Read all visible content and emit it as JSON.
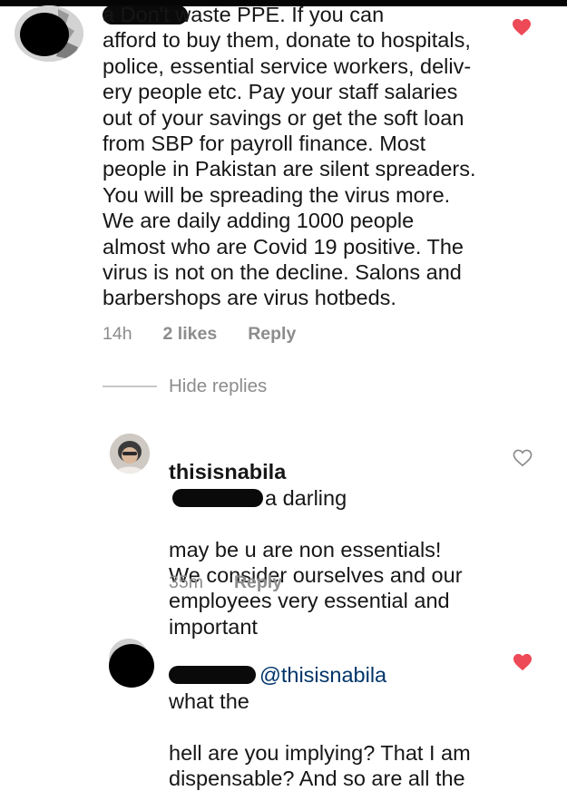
{
  "comments": [
    {
      "text": "a Don't waste PPE. If you can\nafford to buy them, donate to hospitals,\npolice, essential service workers, deliv-\nery people etc. Pay your staff salaries\nout of your savings or get the soft loan\nfrom SBP for payroll finance. Most\npeople in Pakistan are silent spreaders.\nYou will be spreading the virus more.\nWe are daily adding 1000 people\nalmost who are Covid 19 positive. The\nvirus is not on the decline. Salons and\nbarbershops are virus hotbeds.",
      "time": "14h",
      "likes": "2 likes",
      "reply": "Reply",
      "liked": true
    }
  ],
  "hide_replies": "Hide replies",
  "replies": [
    {
      "username": "thisisnabila",
      "text_first": "a darling",
      "text_rest": "may be u are non essentials!\nWe consider ourselves and our\nemployees very essential and\nimportant",
      "time": "35m",
      "reply": "Reply",
      "liked": false
    },
    {
      "mention": "@thisisnabila",
      "text_first": "what the",
      "text_rest": "hell are you implying? That I am\ndispensable? And so are all the",
      "liked": true
    }
  ],
  "colors": {
    "heart_liked": "#ed4956",
    "muted": "#8c8c8c",
    "mention": "#003569"
  },
  "icons": {
    "liked": "heart-filled-icon",
    "unliked": "heart-outline-icon"
  }
}
